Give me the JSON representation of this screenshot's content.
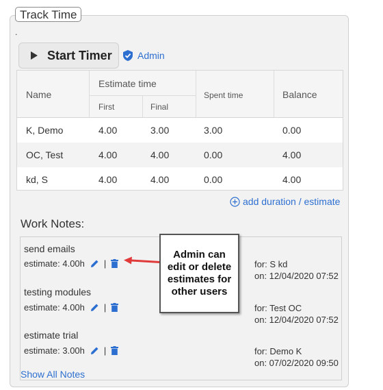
{
  "panel_title": "Track Time",
  "dot": ".",
  "start_timer": {
    "label": "Start Timer"
  },
  "admin_label": "Admin",
  "table": {
    "headers": {
      "name": "Name",
      "estimate": "Estimate time",
      "first": "First",
      "final": "Final",
      "spent": "Spent time",
      "balance": "Balance"
    },
    "rows": [
      {
        "name": "K, Demo",
        "first": "4.00",
        "final": "3.00",
        "spent": "3.00",
        "balance": "0.00"
      },
      {
        "name": "OC, Test",
        "first": "4.00",
        "final": "4.00",
        "spent": "0.00",
        "balance": "4.00"
      },
      {
        "name": "kd, S",
        "first": "4.00",
        "final": "4.00",
        "spent": "0.00",
        "balance": "4.00"
      }
    ]
  },
  "add_link": "add duration / estimate",
  "work_notes": {
    "title": "Work Notes:",
    "notes": [
      {
        "title": "send emails",
        "estimate": "estimate: 4.00h",
        "separator": "|",
        "for": "for: S kd",
        "on": "on: 12/04/2020 07:52"
      },
      {
        "title": "testing modules",
        "estimate": "estimate: 4.00h",
        "separator": "|",
        "for": "for: Test OC",
        "on": "on: 12/04/2020 07:52"
      },
      {
        "title": "estimate trial",
        "estimate": "estimate: 3.00h",
        "separator": "|",
        "for": "for: Demo K",
        "on": "on: 07/02/2020 09:50"
      }
    ],
    "show_all": "Show All Notes"
  },
  "callout": {
    "line1": "Admin can",
    "line2": "edit or delete",
    "line3": "estimates for",
    "line4": "other users"
  },
  "colors": {
    "link": "#2d6fd0",
    "arrow": "#e03a3a",
    "panel_bg": "#f2f2f2"
  }
}
